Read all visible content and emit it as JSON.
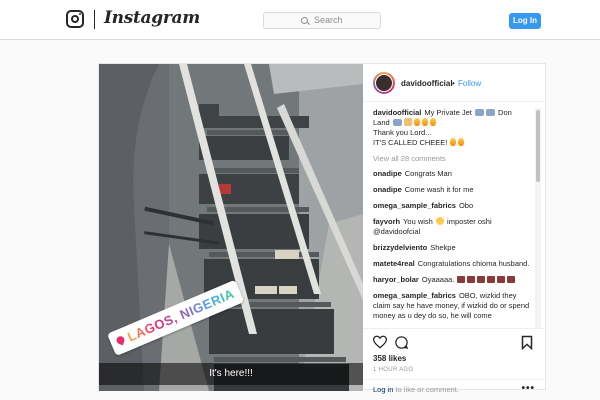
{
  "header": {
    "wordmark": "Instagram",
    "search_placeholder": "Search",
    "login_button": "Log In"
  },
  "post": {
    "username": "davidoofficial",
    "dot": "•",
    "follow": "Follow",
    "geo_sticker": "LAGOS, NIGERIA",
    "photo_caption": "It's here!!!",
    "caption": {
      "user": "davidoofficial",
      "line1": "My Private Jet",
      "line1b": "Don",
      "line2": "Land",
      "line3": "Thank you Lord...",
      "line4": "IT'S CALLED CHEEE!"
    },
    "view_all": "View all 28 comments",
    "comments": [
      {
        "user": "onadipe",
        "text": "Congrats Man"
      },
      {
        "user": "onadipe",
        "text": "Come wash it for me"
      },
      {
        "user": "omega_sample_fabrics",
        "text": "Obo"
      },
      {
        "user": "fayvorh",
        "text": "You wish",
        "text2": "imposter oshi @davidoofcial"
      },
      {
        "user": "brizzydelviento",
        "text": "Shekpe"
      },
      {
        "user": "matete4real",
        "text": "Congratulations chioma husband."
      },
      {
        "user": "haryor_bolar",
        "text": "Oyaaaaa."
      },
      {
        "user": "omega_sample_fabrics",
        "text": "OBO, wizkid they claim say he have money, if wizkid do or spend money as u dey do so, he will come"
      }
    ],
    "likes": "358 likes",
    "time_ago": "1 HOUR AGO",
    "login_prompt_link": "Log in",
    "login_prompt_rest": "to like or comment.",
    "more": "•••"
  }
}
